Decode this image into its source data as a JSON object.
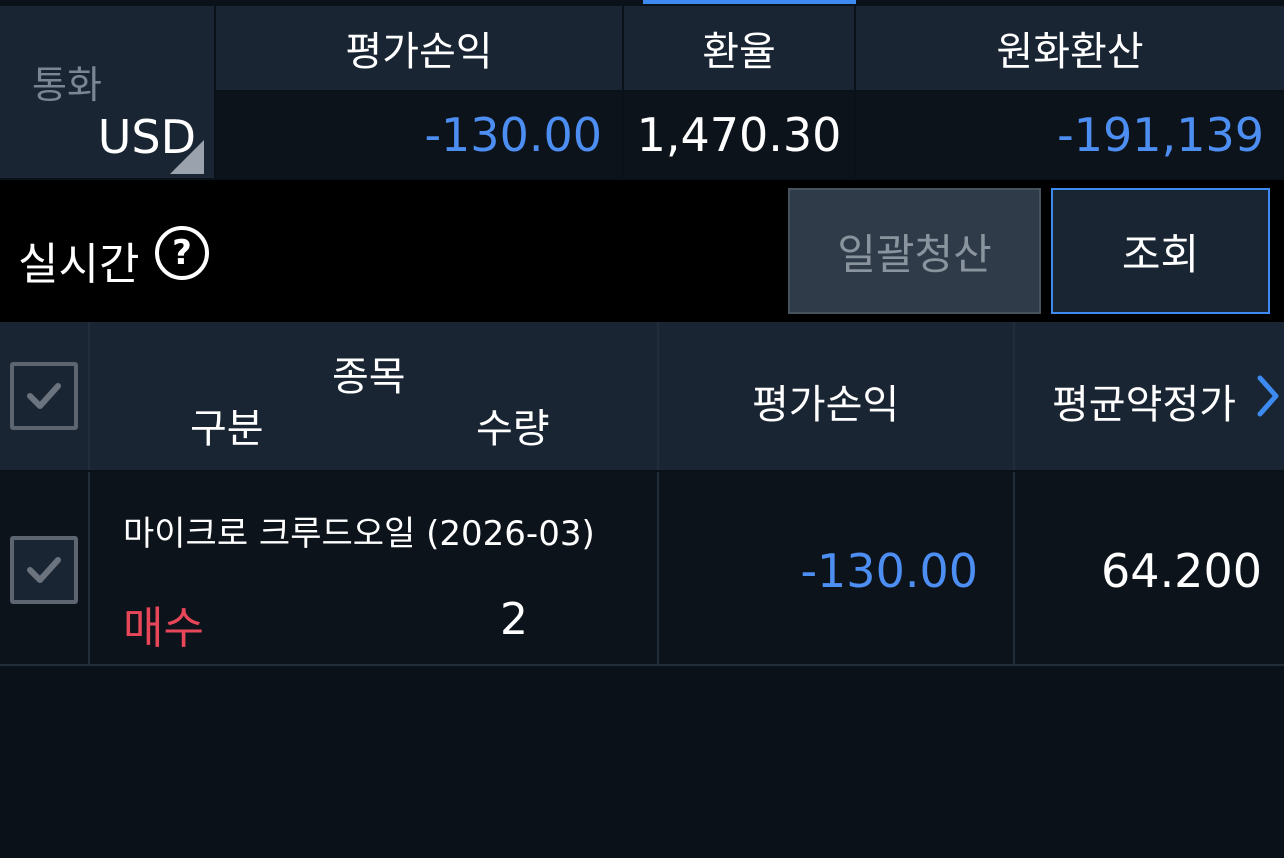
{
  "summary": {
    "currency_label": "통화",
    "currency_value": "USD",
    "headers": {
      "pl": "평가손익",
      "rate": "환율",
      "krw": "원화환산"
    },
    "values": {
      "pl": "-130.00",
      "rate": "1,470.30",
      "krw": "-191,139"
    }
  },
  "realtime": {
    "label": "실시간",
    "help_glyph": "?",
    "liquidate_label": "일괄청산",
    "query_label": "조회"
  },
  "table": {
    "headers": {
      "product": "종목",
      "side": "구분",
      "qty": "수량",
      "pl": "평가손익",
      "avg_price": "평균약정가"
    },
    "rows": [
      {
        "product": "마이크로 크루드오일 (2026-03)",
        "side": "매수",
        "qty": "2",
        "pl": "-130.00",
        "avg_price": "64.200"
      }
    ]
  },
  "colors": {
    "accent": "#3d8bf0",
    "negative": "#4d8ef3",
    "buy": "#e8475a",
    "header_bg": "#1a2533",
    "body_bg": "#0b1119"
  }
}
